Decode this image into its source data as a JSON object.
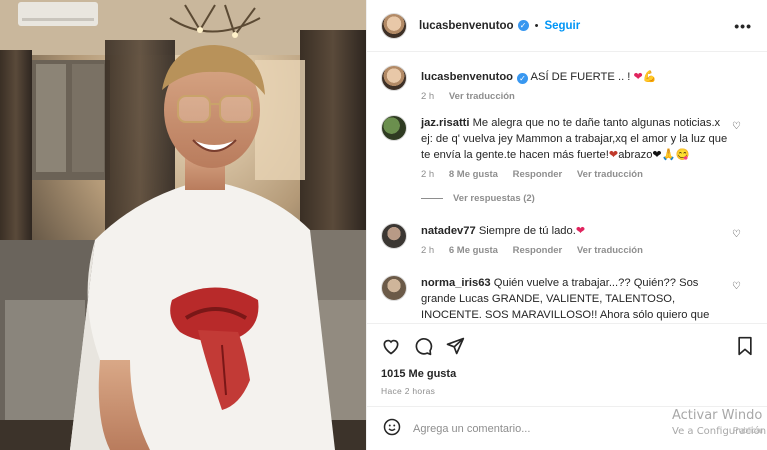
{
  "post": {
    "username": "lucasbenvenutoo",
    "follow_label": "Seguir",
    "caption": "ASÍ DE FUERTE .. !",
    "caption_time": "2 h",
    "translate_label": "Ver traducción"
  },
  "comments": [
    {
      "username": "jaz.risatti",
      "text": "Me alegra que no te dañe tanto algunas noticias.x ej: de q' vuelva jey Mammon a trabajar,xq el amor y la luz que te envía la gente.te hacen más fuerte!",
      "text_tail": "abrazo",
      "time": "2 h",
      "likes": "8 Me gusta",
      "reply_label": "Responder",
      "translate_label": "Ver traducción",
      "view_replies": "Ver respuestas (2)"
    },
    {
      "username": "natadev77",
      "text": "Siempre de tú lado.",
      "time": "2 h",
      "likes": "6 Me gusta",
      "reply_label": "Responder",
      "translate_label": "Ver traducción"
    },
    {
      "username": "norma_iris63",
      "text": "Quién vuelve a trabajar...?? Quién?? Sos grande Lucas GRANDE, VALIENTE, TALENTOSO, INOCENTE. SOS MARAVILLOSO!! Ahora sólo quiero que seas FELIZ! TODO LO"
    }
  ],
  "footer": {
    "likes": "1015 Me gusta",
    "ago": "Hace 2 horas",
    "comment_placeholder": "Agrega un comentario..."
  },
  "overlay": {
    "activate_title": "Activar Windo",
    "activate_sub": "Ve a Configuración",
    "publish_label": "Publicar"
  },
  "colors": {
    "accent": "#0095f6",
    "verified": "#3897f0",
    "muted": "#8e8e8e",
    "heart_red": "#e0245e"
  }
}
